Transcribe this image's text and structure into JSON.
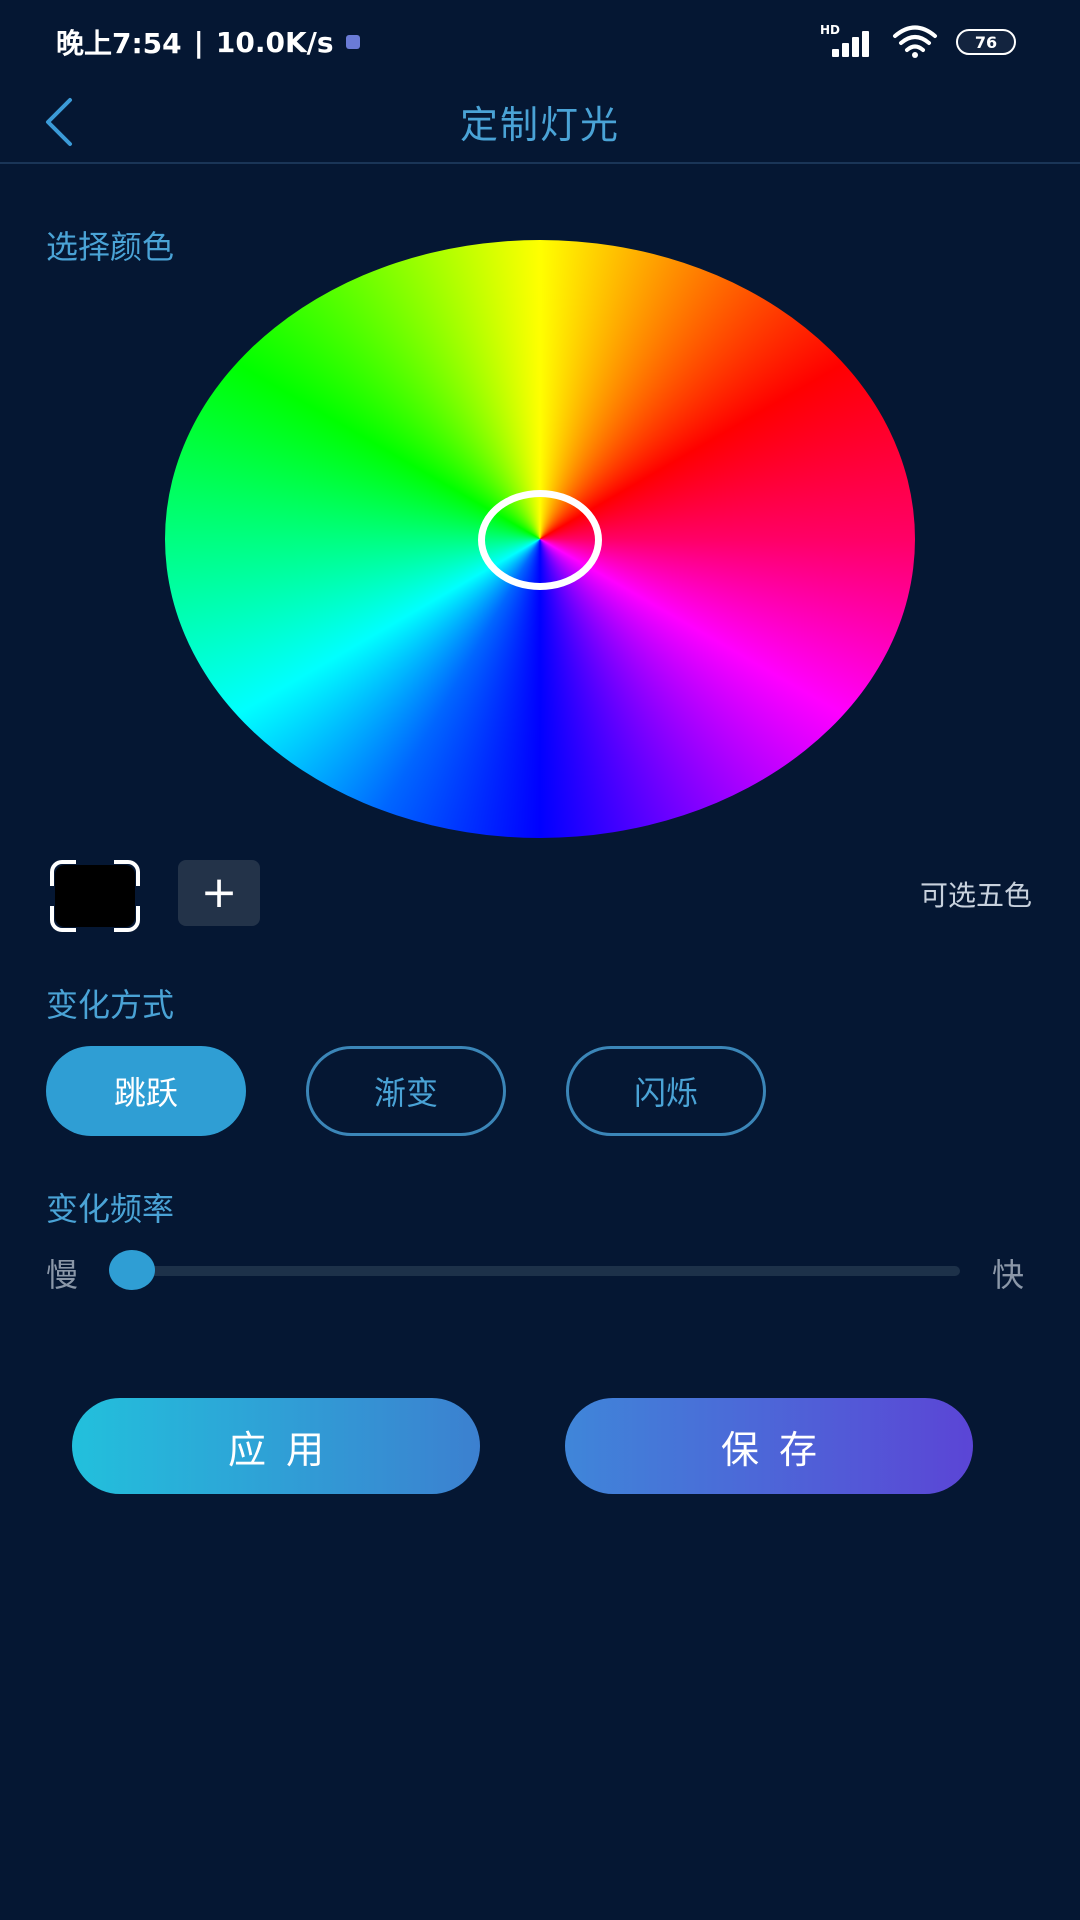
{
  "status_bar": {
    "time": "晚上7:54",
    "separator": "|",
    "net_speed": "10.0K/s",
    "signal_label": "HD",
    "battery": "76"
  },
  "header": {
    "title": "定制灯光"
  },
  "color_section": {
    "label": "选择颜色",
    "selected_color": "#000000",
    "hint": "可选五色"
  },
  "mode_section": {
    "label": "变化方式",
    "options": [
      {
        "label": "跳跃",
        "active": true
      },
      {
        "label": "渐变",
        "active": false
      },
      {
        "label": "闪烁",
        "active": false
      }
    ]
  },
  "frequency_section": {
    "label": "变化频率",
    "min_label": "慢",
    "max_label": "快",
    "value_percent": 0
  },
  "actions": {
    "apply_label": "应用",
    "save_label": "保存"
  },
  "colors": {
    "background": "#051733",
    "accent": "#2f9ed4",
    "text_accent": "#4aa3d6"
  }
}
